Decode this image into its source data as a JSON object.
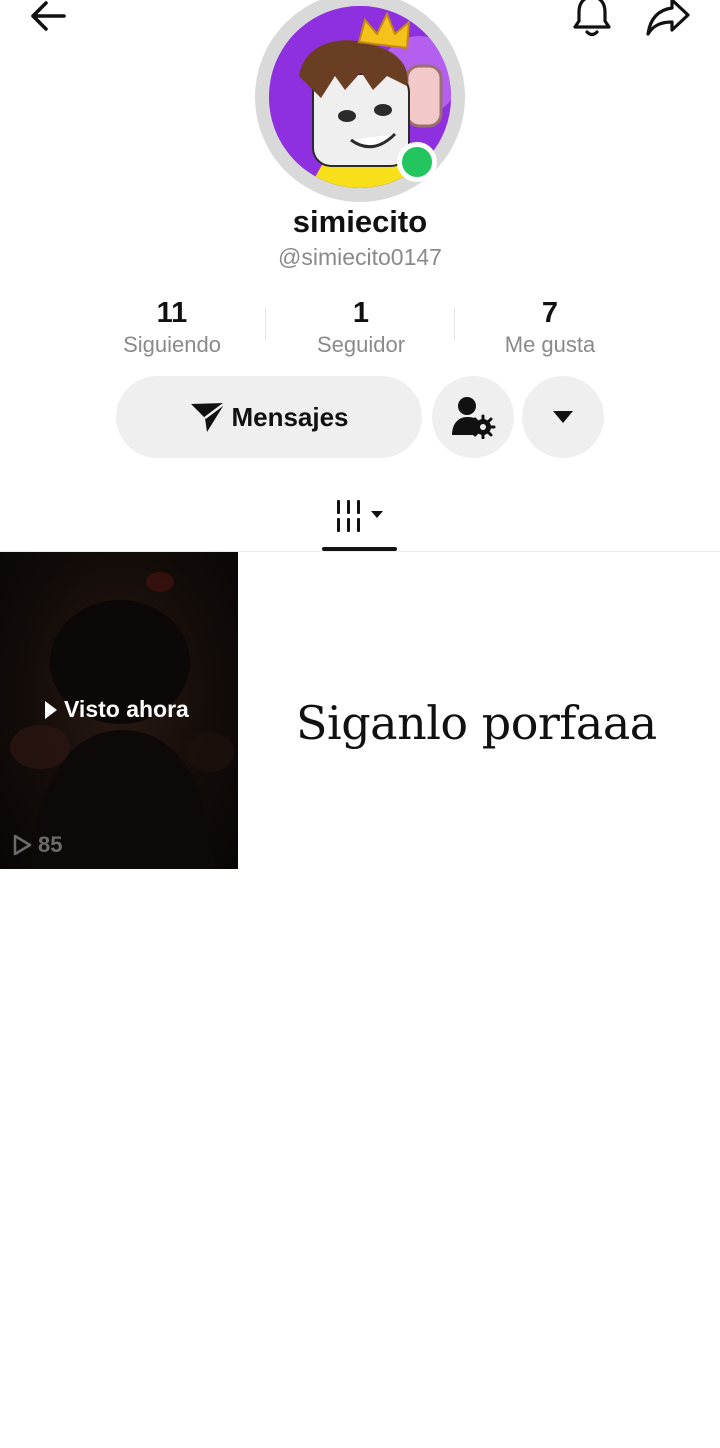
{
  "profile": {
    "display_name": "simiecito",
    "username": "@simiecito0147",
    "online": true
  },
  "stats": {
    "following": {
      "value": "11",
      "label": "Siguiendo"
    },
    "followers": {
      "value": "1",
      "label": "Seguidor"
    },
    "likes": {
      "value": "7",
      "label": "Me gusta"
    }
  },
  "actions": {
    "messages_label": "Mensajes"
  },
  "icons": {
    "back": "arrow-left-icon",
    "notifications": "bell-icon",
    "share": "share-arrow-icon",
    "messages": "paper-plane-icon",
    "friend_settings": "user-gear-icon",
    "more": "caret-down-icon",
    "tab": "grid-icon"
  },
  "video": {
    "watched_label": "Visto ahora",
    "views": "85"
  },
  "bio_text": "Siganlo porfaaa",
  "colors": {
    "online": "#22c55e",
    "avatar_bg": "#8e2fe0",
    "button_bg": "#efefef",
    "secondary_text": "#8a8a8a"
  }
}
